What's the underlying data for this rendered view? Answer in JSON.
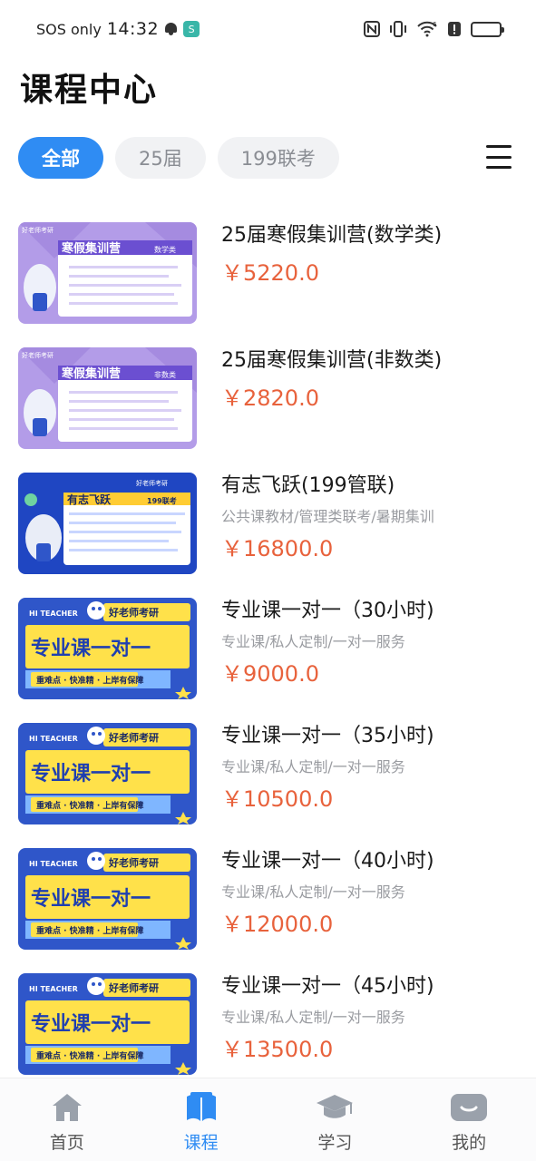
{
  "status_bar": {
    "carrier": "SOS only",
    "time": "14:32",
    "app_badge": "S",
    "network": "6"
  },
  "page_title": "课程中心",
  "tabs": [
    {
      "label": "全部",
      "active": true
    },
    {
      "label": "25届",
      "active": false
    },
    {
      "label": "199联考",
      "active": false
    }
  ],
  "courses": [
    {
      "title": "25届寒假集训营(数学类)",
      "tags": "",
      "price": "￥5220.0",
      "thumb": {
        "style": "purple",
        "brand": "好老师考研",
        "heading": "寒假集训营",
        "tag": "数学类"
      }
    },
    {
      "title": "25届寒假集训营(非数类)",
      "tags": "",
      "price": "￥2820.0",
      "thumb": {
        "style": "purple",
        "brand": "好老师考研",
        "heading": "寒假集训营",
        "tag": "非数类"
      }
    },
    {
      "title": "有志飞跃(199管联)",
      "tags": "公共课教材/管理类联考/暑期集训",
      "price": "￥16800.0",
      "thumb": {
        "style": "blue",
        "brand": "好老师考研",
        "heading": "有志飞跃",
        "tag": "199联考"
      }
    },
    {
      "title": "专业课一对一（30小时)",
      "tags": "专业课/私人定制/一对一服务",
      "price": "￥9000.0",
      "thumb": {
        "style": "yellow",
        "brand": "好老师考研",
        "teacher": "HI TEACHER",
        "heading": "专业课一对一",
        "slogan": "重难点 · 快准精 · 上岸有保障"
      }
    },
    {
      "title": "专业课一对一（35小时)",
      "tags": "专业课/私人定制/一对一服务",
      "price": "￥10500.0",
      "thumb": {
        "style": "yellow",
        "brand": "好老师考研",
        "teacher": "HI TEACHER",
        "heading": "专业课一对一",
        "slogan": "重难点 · 快准精 · 上岸有保障"
      }
    },
    {
      "title": "专业课一对一（40小时)",
      "tags": "专业课/私人定制/一对一服务",
      "price": "￥12000.0",
      "thumb": {
        "style": "yellow",
        "brand": "好老师考研",
        "teacher": "HI TEACHER",
        "heading": "专业课一对一",
        "slogan": "重难点 · 快准精 · 上岸有保障"
      }
    },
    {
      "title": "专业课一对一（45小时)",
      "tags": "专业课/私人定制/一对一服务",
      "price": "￥13500.0",
      "thumb": {
        "style": "yellow",
        "brand": "好老师考研",
        "teacher": "HI TEACHER",
        "heading": "专业课一对一",
        "slogan": "重难点 · 快准精 · 上岸有保障"
      }
    }
  ],
  "bottom_nav": [
    {
      "label": "首页",
      "icon": "home-icon",
      "active": false
    },
    {
      "label": "课程",
      "icon": "book-icon",
      "active": true
    },
    {
      "label": "学习",
      "icon": "graduation-cap-icon",
      "active": false
    },
    {
      "label": "我的",
      "icon": "profile-icon",
      "active": false
    }
  ],
  "colors": {
    "accent": "#2f8cf3",
    "price": "#e8623c",
    "tag_text": "#9a9ca1",
    "tab_bg": "#f1f2f4"
  }
}
